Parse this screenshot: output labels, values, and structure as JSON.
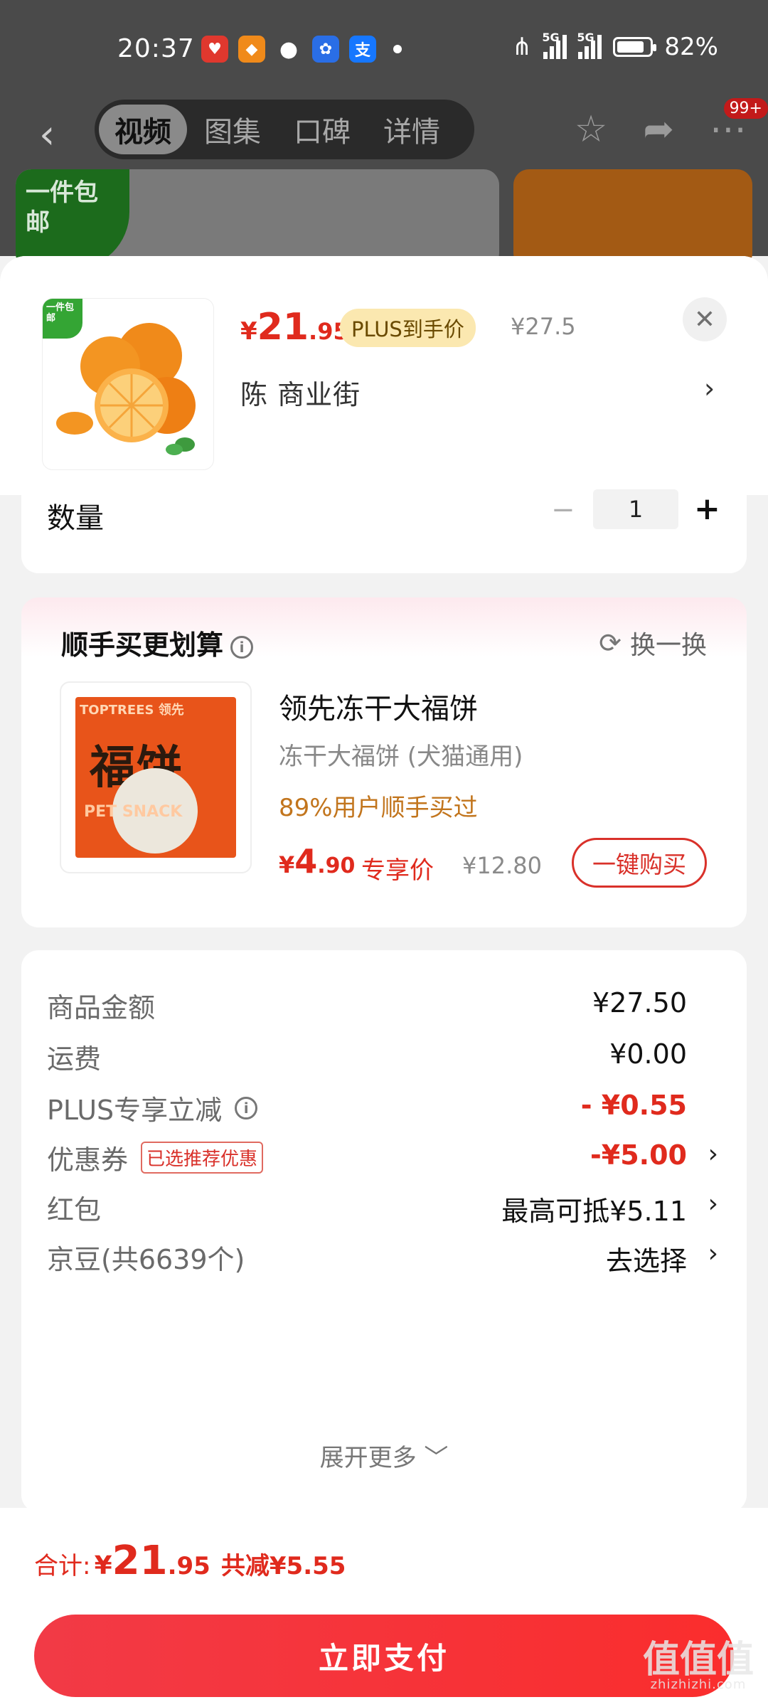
{
  "status_bar": {
    "time": "20:37",
    "battery": "82%",
    "network_1": "5G",
    "network_2": "5G"
  },
  "nav": {
    "tabs": [
      {
        "label": "视频",
        "active": true
      },
      {
        "label": "图集",
        "active": false
      },
      {
        "label": "口碑",
        "active": false
      },
      {
        "label": "详情",
        "active": false
      }
    ],
    "badge": "99+"
  },
  "background": {
    "tag": "一件包邮"
  },
  "sheet": {
    "product": {
      "tag": "一件包邮",
      "price_symbol": "¥",
      "price_int": "21",
      "price_dec": ".95",
      "plus_label": "PLUS到手价",
      "original_price": "¥27.5",
      "address": "陈  商业街"
    },
    "quantity": {
      "label": "数量",
      "value": "1"
    },
    "upsell": {
      "title": "顺手买更划算",
      "swap": "换一换",
      "brand": "TOPTREES 领先",
      "box_title": "福饼",
      "box_sub": "PET SNACK",
      "name": "领先冻干大福饼",
      "subtitle": "冻干大福饼  (犬猫通用)",
      "stat": "89%用户顺手买过",
      "price_symbol": "¥",
      "price_int": "4",
      "price_dec": ".90",
      "price_label": "专享价",
      "original_price": "¥12.80",
      "buy_button": "一键购买"
    },
    "summary": {
      "rows": [
        {
          "label": "商品金额",
          "value": "¥27.50"
        },
        {
          "label": "运费",
          "value": "¥0.00"
        },
        {
          "label": "PLUS专享立减",
          "value": "- ¥0.55"
        },
        {
          "label": "优惠券",
          "tag": "已选推荐优惠",
          "value": "-¥5.00"
        },
        {
          "label": "红包",
          "value": "最高可抵¥5.11"
        },
        {
          "label": "京豆(共6639个)",
          "value": "去选择"
        }
      ],
      "expand": "展开更多"
    },
    "footer": {
      "total_label": "合计:",
      "total_symbol": "¥",
      "total_int": "21",
      "total_dec": ".95",
      "discount": "共减¥5.55",
      "pay_button": "立即支付"
    }
  },
  "watermark": {
    "mark": "值值值",
    "site": "zhizhizhi.com"
  },
  "colors": {
    "accent_red": "#e02a1d",
    "pay_button": "#f23a46",
    "plus_pill": "#fbe8b0",
    "stat_orange": "#c2751d"
  }
}
